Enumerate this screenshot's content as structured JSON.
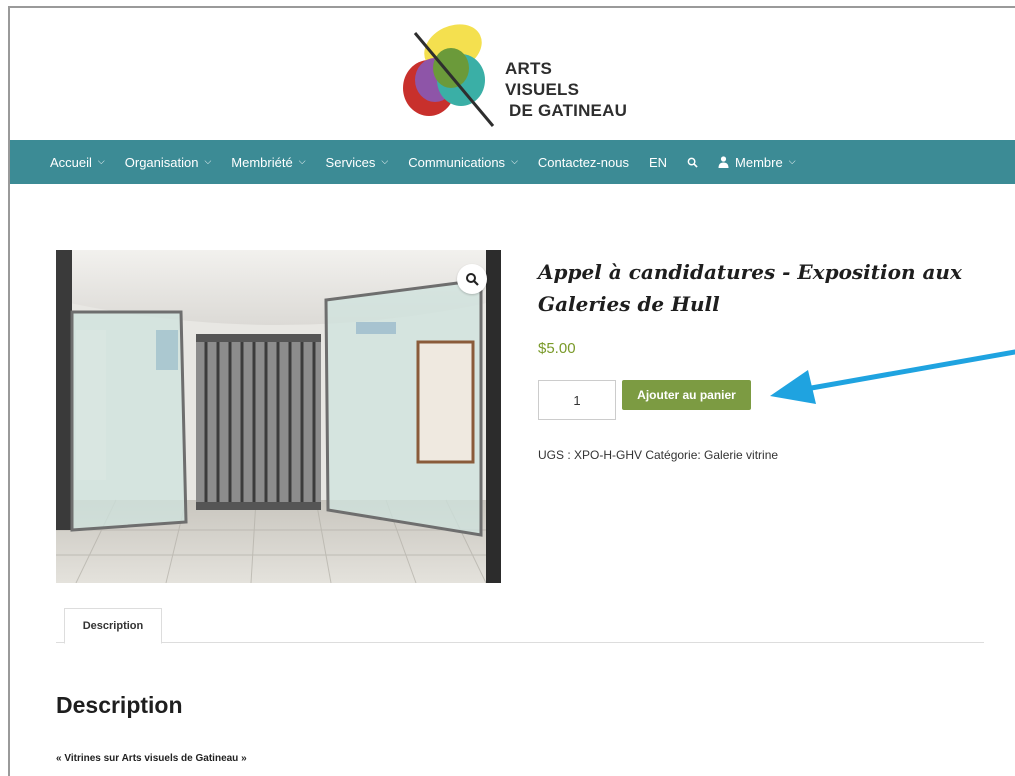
{
  "logo": {
    "line1": "ARTS",
    "line2": "VISUELS",
    "line3": "DE GATINEAU",
    "colors": {
      "yellow": "#f3de46",
      "purple": "#8e55a8",
      "green": "#6b9a3a",
      "teal": "#3aafa6",
      "red": "#c8302c"
    }
  },
  "nav": {
    "background": "#3c8b95",
    "items": [
      {
        "label": "Accueil",
        "has_dropdown": true
      },
      {
        "label": "Organisation",
        "has_dropdown": true
      },
      {
        "label": "Membriété",
        "has_dropdown": true
      },
      {
        "label": "Services",
        "has_dropdown": true
      },
      {
        "label": "Communications",
        "has_dropdown": true
      },
      {
        "label": "Contactez-nous",
        "has_dropdown": false
      },
      {
        "label": "EN",
        "has_dropdown": false
      }
    ],
    "search_icon": "search-icon",
    "member": {
      "label": "Membre",
      "icon": "user-icon",
      "has_dropdown": true
    }
  },
  "product": {
    "title": "Appel à candidatures - Exposition aux Galeries de Hull",
    "price": "$5.00",
    "quantity": "1",
    "add_to_cart_label": "Ajouter au panier",
    "meta": "UGS : XPO-H-GHV Catégorie: Galerie vitrine",
    "zoom_icon": "magnifier-icon",
    "price_color": "#7a9a2a",
    "button_color": "#7c9b42"
  },
  "annotation": {
    "arrow_color": "#1fa3e0",
    "icon": "arrow-pointer-icon"
  },
  "tabs": [
    {
      "label": "Description"
    }
  ],
  "description": {
    "heading": "Description",
    "text": "« Vitrines sur Arts visuels de Gatineau »"
  }
}
